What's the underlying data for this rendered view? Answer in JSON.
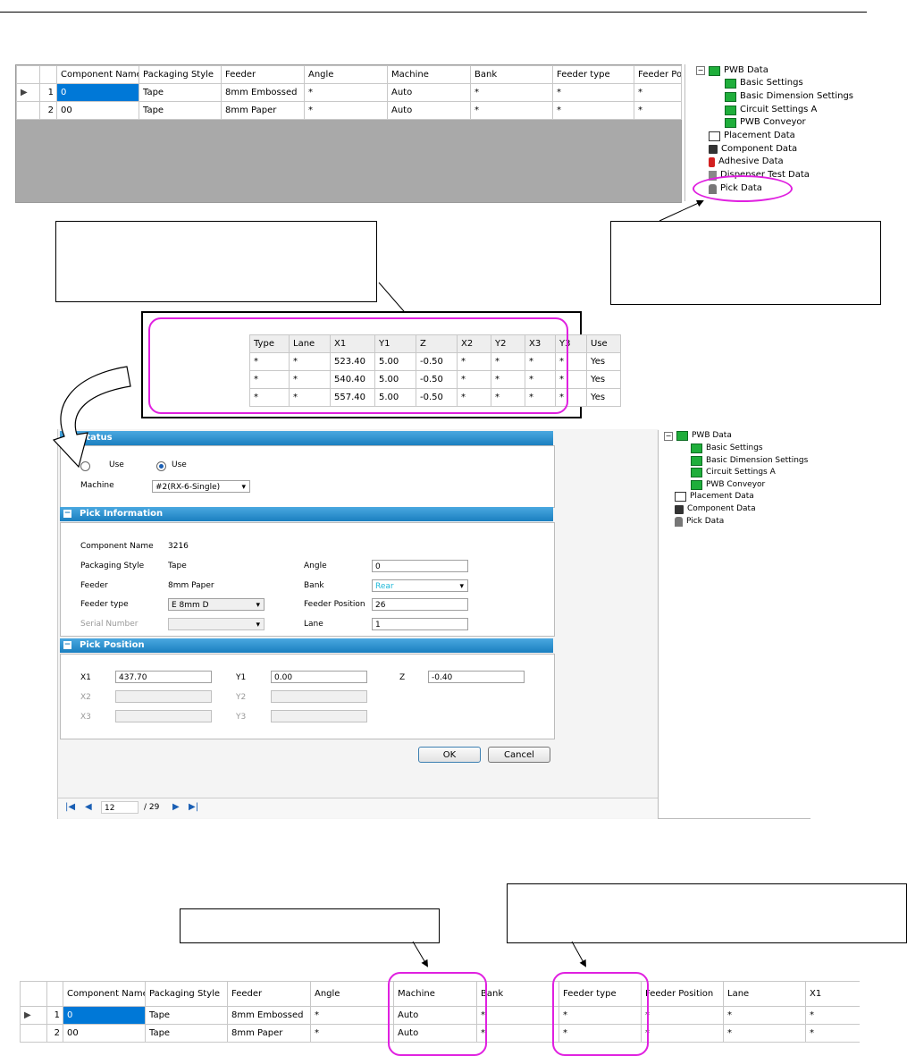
{
  "grid_top": {
    "headers": [
      "Component Name",
      "Packaging Style",
      "Feeder",
      "Angle",
      "Machine",
      "Bank",
      "Feeder type",
      "Feeder Position"
    ],
    "rows": [
      [
        "0",
        "Tape",
        "8mm Embossed",
        "*",
        "Auto",
        "*",
        "*",
        "*"
      ],
      [
        "00",
        "Tape",
        "8mm Paper",
        "*",
        "Auto",
        "*",
        "*",
        "*"
      ]
    ],
    "row_numbers": [
      "1",
      "2"
    ]
  },
  "tree_top": {
    "items": [
      "PWB Data",
      "Basic Settings",
      "Basic Dimension Settings",
      "Circuit Settings A",
      "PWB Conveyor",
      "Placement Data",
      "Component Data",
      "Adhesive Data",
      "Dispenser Test Data",
      "Pick Data"
    ]
  },
  "pick_grid": {
    "headers": [
      "Type",
      "Lane",
      "X1",
      "Y1",
      "Z",
      "X2",
      "Y2",
      "X3",
      "Y3",
      "Use"
    ],
    "rows": [
      [
        "*",
        "*",
        "523.40",
        "5.00",
        "-0.50",
        "*",
        "*",
        "*",
        "*",
        "Yes"
      ],
      [
        "*",
        "*",
        "540.40",
        "5.00",
        "-0.50",
        "*",
        "*",
        "*",
        "*",
        "Yes"
      ],
      [
        "*",
        "*",
        "557.40",
        "5.00",
        "-0.50",
        "*",
        "*",
        "*",
        "*",
        "Yes"
      ]
    ]
  },
  "dialog": {
    "status_header": "Status",
    "radio_not_use": "Use",
    "radio_use": "Use",
    "machine_label": "Machine",
    "machine_value": "#2(RX-6-Single)",
    "pick_info_header": "Pick Information",
    "component_name_label": "Component Name",
    "component_name_value": "3216",
    "packaging_label": "Packaging Style",
    "packaging_value": "Tape",
    "feeder_label": "Feeder",
    "feeder_value": "8mm Paper",
    "feeder_type_label": "Feeder type",
    "feeder_type_value": "E 8mm D",
    "serial_label": "Serial Number",
    "angle_label": "Angle",
    "angle_value": "0",
    "bank_label": "Bank",
    "bank_value": "Rear",
    "feeder_pos_label": "Feeder Position",
    "feeder_pos_value": "26",
    "lane_label": "Lane",
    "lane_value": "1",
    "pick_pos_header": "Pick Position",
    "x1_label": "X1",
    "x1_value": "437.70",
    "y1_label": "Y1",
    "y1_value": "0.00",
    "z_label": "Z",
    "z_value": "-0.40",
    "x2_label": "X2",
    "y2_label": "Y2",
    "x3_label": "X3",
    "y3_label": "Y3",
    "ok_label": "OK",
    "cancel_label": "Cancel"
  },
  "navigator": {
    "current": "12",
    "total": "/ 29"
  },
  "tree_mid": {
    "items": [
      "PWB Data",
      "Basic Settings",
      "Basic Dimension Settings",
      "Circuit Settings A",
      "PWB Conveyor",
      "Placement Data",
      "Component Data",
      "Pick Data"
    ]
  },
  "grid_bottom": {
    "headers": [
      "Component Name",
      "Packaging Style",
      "Feeder",
      "Angle",
      "Machine",
      "Bank",
      "Feeder type",
      "Feeder Position",
      "Lane",
      "X1"
    ],
    "rows": [
      [
        "0",
        "Tape",
        "8mm Embossed",
        "*",
        "Auto",
        "*",
        "*",
        "*",
        "*",
        "*"
      ],
      [
        "00",
        "Tape",
        "8mm Paper",
        "*",
        "Auto",
        "*",
        "*",
        "*",
        "*",
        "*"
      ]
    ],
    "row_numbers": [
      "1",
      "2"
    ]
  },
  "colors": {
    "highlight": "#e020e0",
    "selection": "#0078d7",
    "section_header": "#1a7fc0"
  }
}
